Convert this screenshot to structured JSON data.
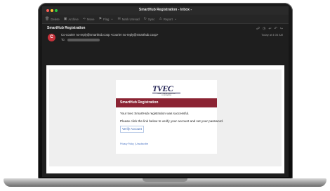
{
  "window": {
    "title": "SmartHub Registration - Inbox -"
  },
  "toolbar": {
    "items": [
      {
        "icon": "trash-icon",
        "label": "Delete"
      },
      {
        "icon": "archive-icon",
        "label": "Archive"
      },
      {
        "icon": "move-icon",
        "label": "Move"
      },
      {
        "icon": "flag-icon",
        "label": "Flag"
      },
      {
        "icon": "mark-unread-icon",
        "label": "Mark Unread"
      },
      {
        "icon": "sync-icon",
        "label": "Sync"
      },
      {
        "icon": "report-icon",
        "label": "Report"
      }
    ]
  },
  "message": {
    "subject": "SmartHub Registration",
    "avatar_initial": "C",
    "from": "Co-courier no-reply@smarthub.coop <courier no-reply@smarthub.coop>",
    "to_label": "To:",
    "date": "Today at 4:06 AM"
  },
  "email": {
    "logo_text": "TVEC",
    "logo_tagline": "TRINITY VALLEY ELECTRIC COOPERATIVE",
    "banner": "SmartHub Registration",
    "line1": "Your tvec SmartHub registration was successful.",
    "line2": "Please click the link below to verify your account and set your password.",
    "verify_link": "Verify Account",
    "footer_links": "Privacy Policy | Unsubscribe"
  },
  "colors": {
    "banner": "#8b2333",
    "avatar": "#c7323b",
    "link": "#2f5fb3"
  }
}
